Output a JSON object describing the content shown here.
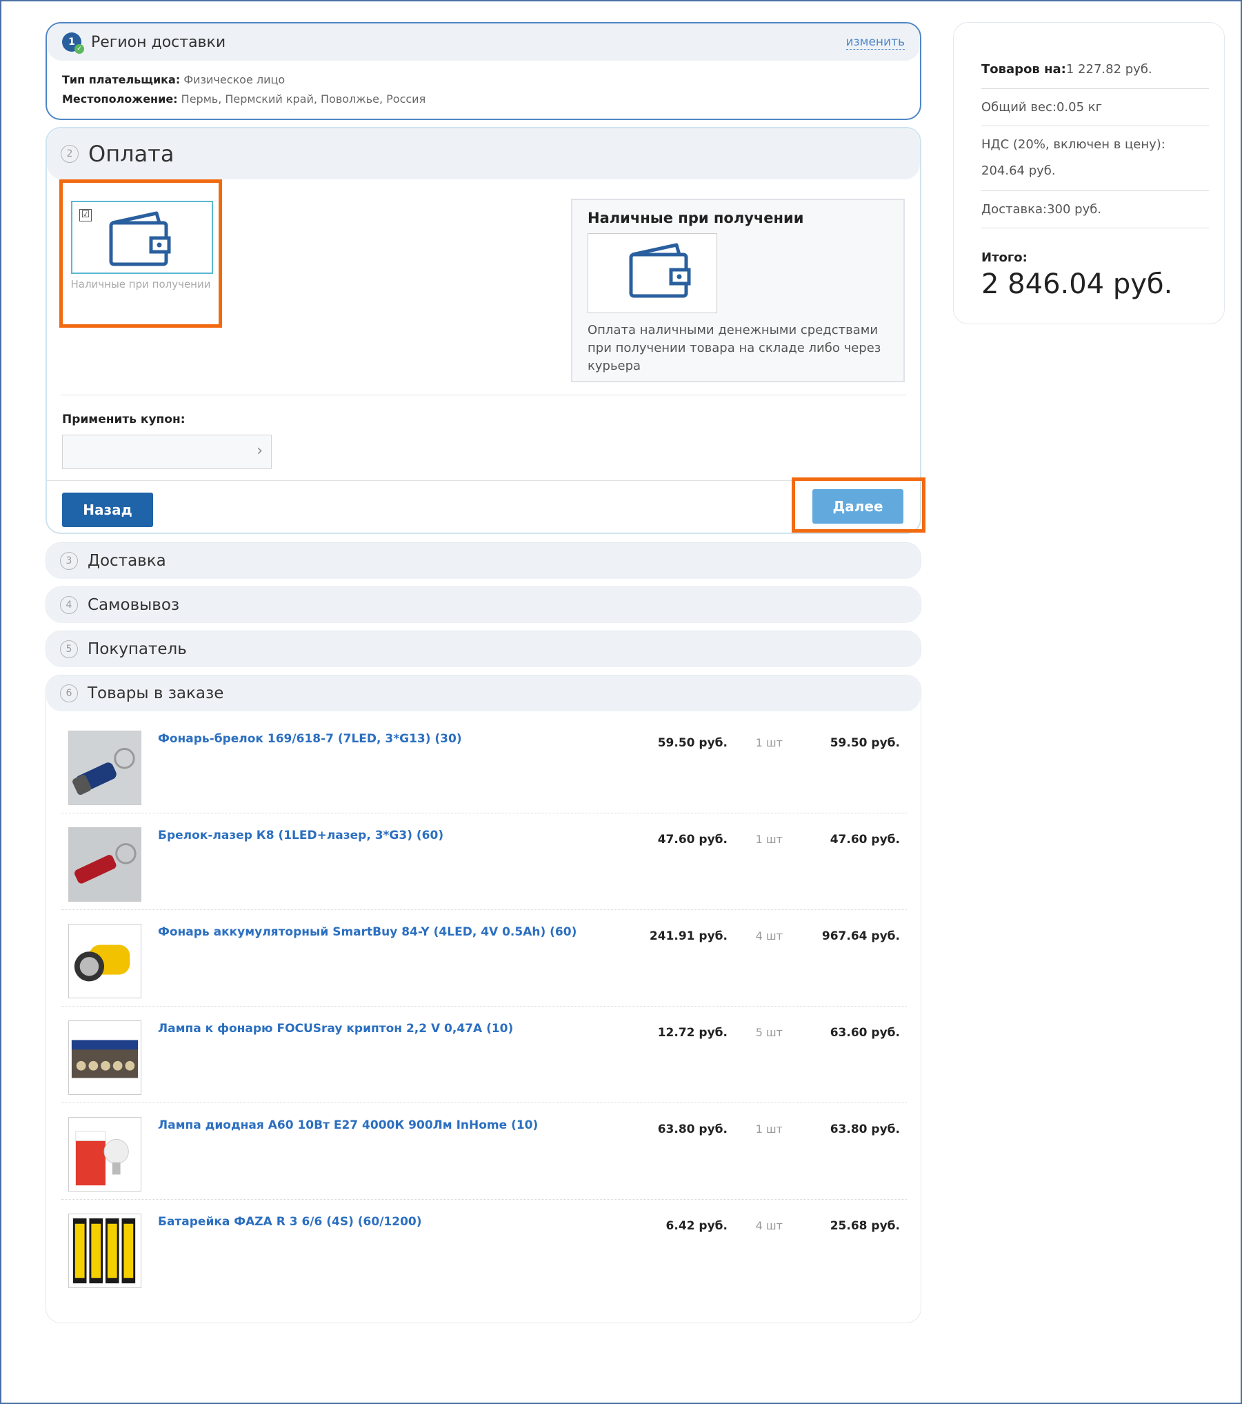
{
  "region": {
    "step": "1",
    "title": "Регион доставки",
    "change_link": "изменить",
    "payer_type_label": "Тип плательщика:",
    "payer_type_value": "Физическое лицо",
    "location_label": "Местоположение:",
    "location_value": "Пермь, Пермский край, Поволжье, Россия"
  },
  "payment": {
    "step": "2",
    "title": "Оплата",
    "option_label": "Наличные при получении",
    "option_checked": "☑",
    "desc_title": "Наличные при получении",
    "desc_text": "Оплата наличными денежными средствами при получении товара на складе либо через курьера",
    "coupon_label": "Применить купон:",
    "coupon_placeholder": "",
    "coupon_arrow": "›",
    "back_button": "Назад",
    "next_button": "Далее"
  },
  "sections": [
    {
      "step": "3",
      "title": "Доставка"
    },
    {
      "step": "4",
      "title": "Самовывоз"
    },
    {
      "step": "5",
      "title": "Покупатель"
    }
  ],
  "goods": {
    "step": "6",
    "title": "Товары в заказе",
    "items": [
      {
        "name": "Фонарь-брелок 169/618-7 (7LED, 3*G13) (30)",
        "price": "59.50 руб.",
        "qty": "1 шт",
        "sum": "59.50 руб."
      },
      {
        "name": "Брелок-лазер К8 (1LED+лазер, 3*G3) (60)",
        "price": "47.60 руб.",
        "qty": "1 шт",
        "sum": "47.60 руб."
      },
      {
        "name": "Фонарь аккумуляторный SmartBuy 84-Y (4LED, 4V 0.5Ah) (60)",
        "price": "241.91 руб.",
        "qty": "4 шт",
        "sum": "967.64 руб."
      },
      {
        "name": "Лампа к фонарю FOCUSray криптон 2,2 V 0,47А (10)",
        "price": "12.72 руб.",
        "qty": "5 шт",
        "sum": "63.60 руб."
      },
      {
        "name": "Лампа диодная А60 10Вт Е27 4000К 900Лм InHome (10)",
        "price": "63.80 руб.",
        "qty": "1 шт",
        "sum": "63.80 руб."
      },
      {
        "name": "Батарейка ФАZA R 3 6/6 (4S) (60/1200)",
        "price": "6.42 руб.",
        "qty": "4 шт",
        "sum": "25.68 руб."
      }
    ]
  },
  "summary": {
    "goods_label": "Товаров на:",
    "goods_value": "1 227.82 руб.",
    "weight_label": "Общий вес:",
    "weight_value": "0.05 кг",
    "vat_label": "НДС (20%, включен в цену):",
    "vat_value": "204.64 руб.",
    "delivery_label": "Доставка:",
    "delivery_value": "300 руб.",
    "total_label": "Итого:",
    "total_value": "2 846.04 руб."
  },
  "colors": {
    "accent_blue": "#1f63a8",
    "link_blue": "#2b6fc0",
    "next_button": "#62a9dd",
    "highlight_orange": "#f26a10"
  },
  "icons": {
    "wallet": "wallet-icon",
    "check": "check-icon",
    "arrow": "chevron-right-icon"
  }
}
